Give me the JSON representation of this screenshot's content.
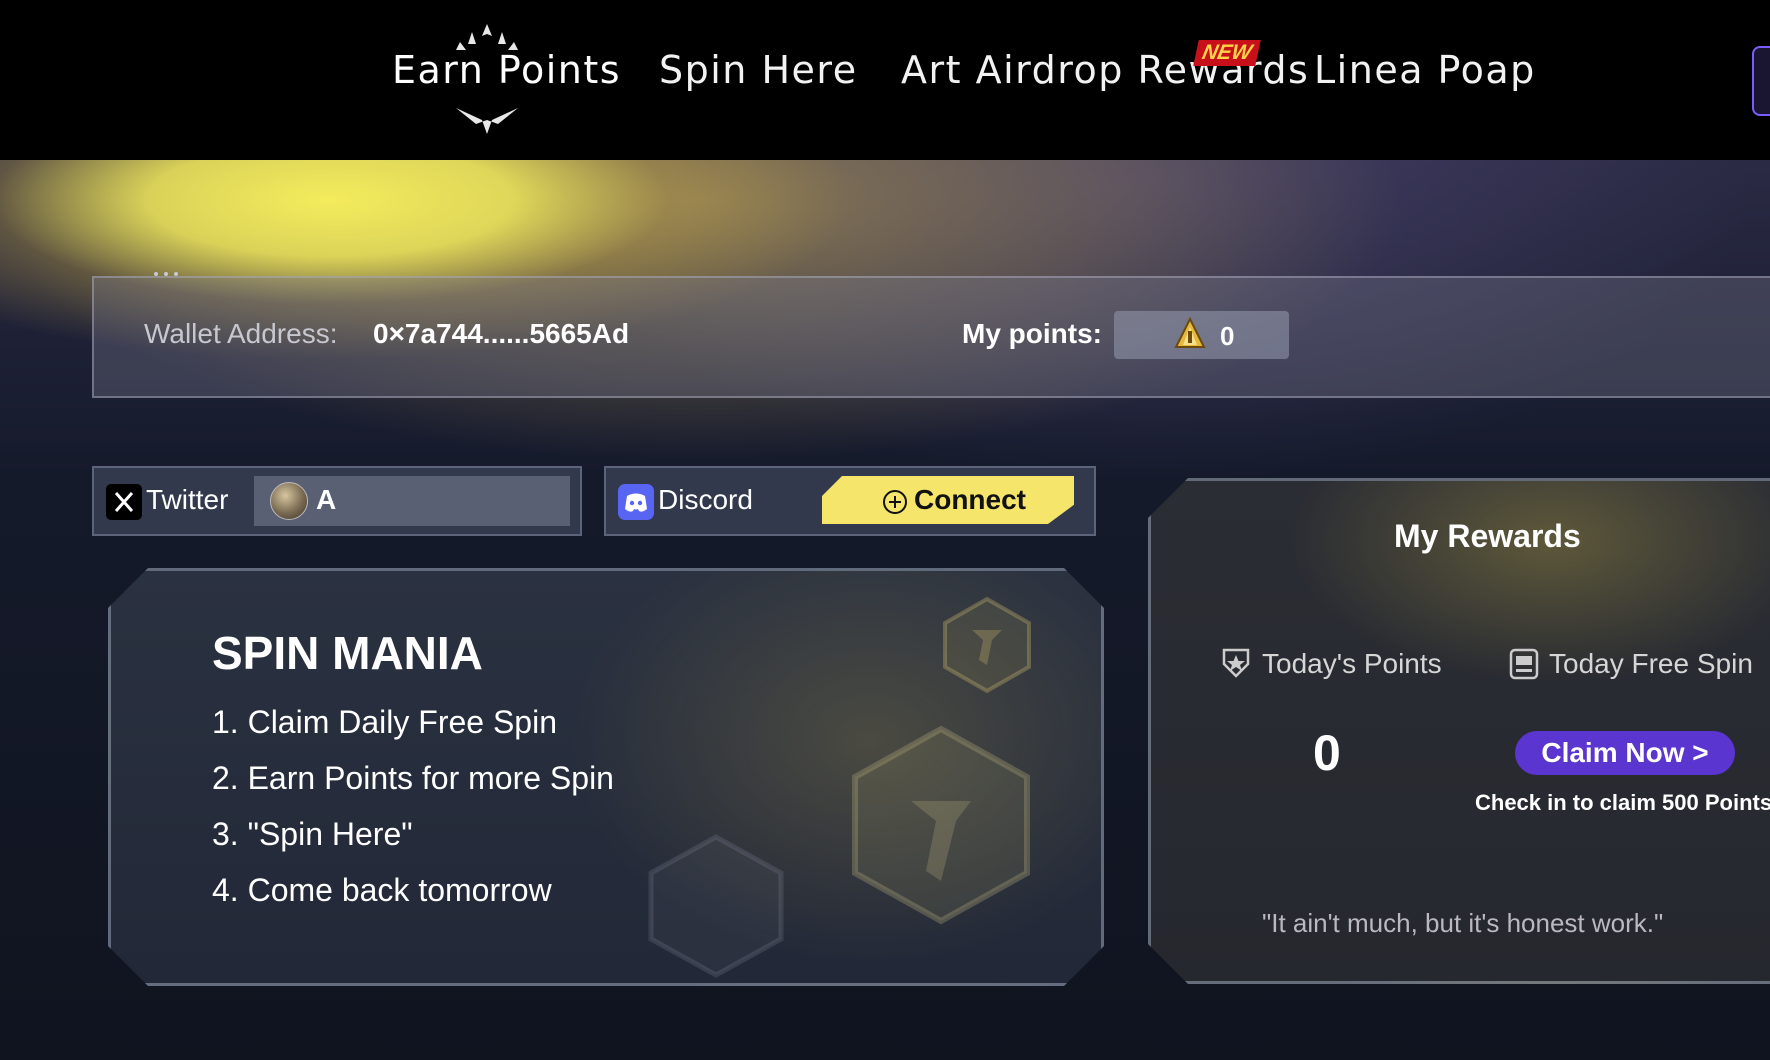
{
  "nav": {
    "items": [
      {
        "label": "Earn Points",
        "active": true
      },
      {
        "label": "Spin Here"
      },
      {
        "label": "Art Airdrop Rewards",
        "badge": "NEW"
      },
      {
        "label": "Linea Poap"
      }
    ]
  },
  "wallet": {
    "address_label": "Wallet Address:",
    "address_value": "0×7a744......5665Ad",
    "points_label": "My points:",
    "points_value": "0"
  },
  "social": {
    "twitter_label": "Twitter",
    "twitter_user": "A",
    "discord_label": "Discord",
    "connect_label": "Connect"
  },
  "spin": {
    "title": "SPIN MANIA",
    "steps": [
      "1. Claim Daily Free Spin",
      "2. Earn Points for more Spin",
      "3. \"Spin Here\"",
      "4. Come back tomorrow"
    ]
  },
  "rewards": {
    "title": "My Rewards",
    "todays_points_label": "Today's Points",
    "free_spin_label": "Today Free Spin",
    "todays_points_value": "0",
    "claim_button": "Claim Now >",
    "claim_note": "Check in to claim 500 Points",
    "quote": "\"It ain't much, but it's honest work.\""
  },
  "colors": {
    "accent_yellow": "#f5e56b",
    "claim_purple": "#5b35cf",
    "badge_red": "#c8101a",
    "discord_blue": "#5865f2"
  }
}
